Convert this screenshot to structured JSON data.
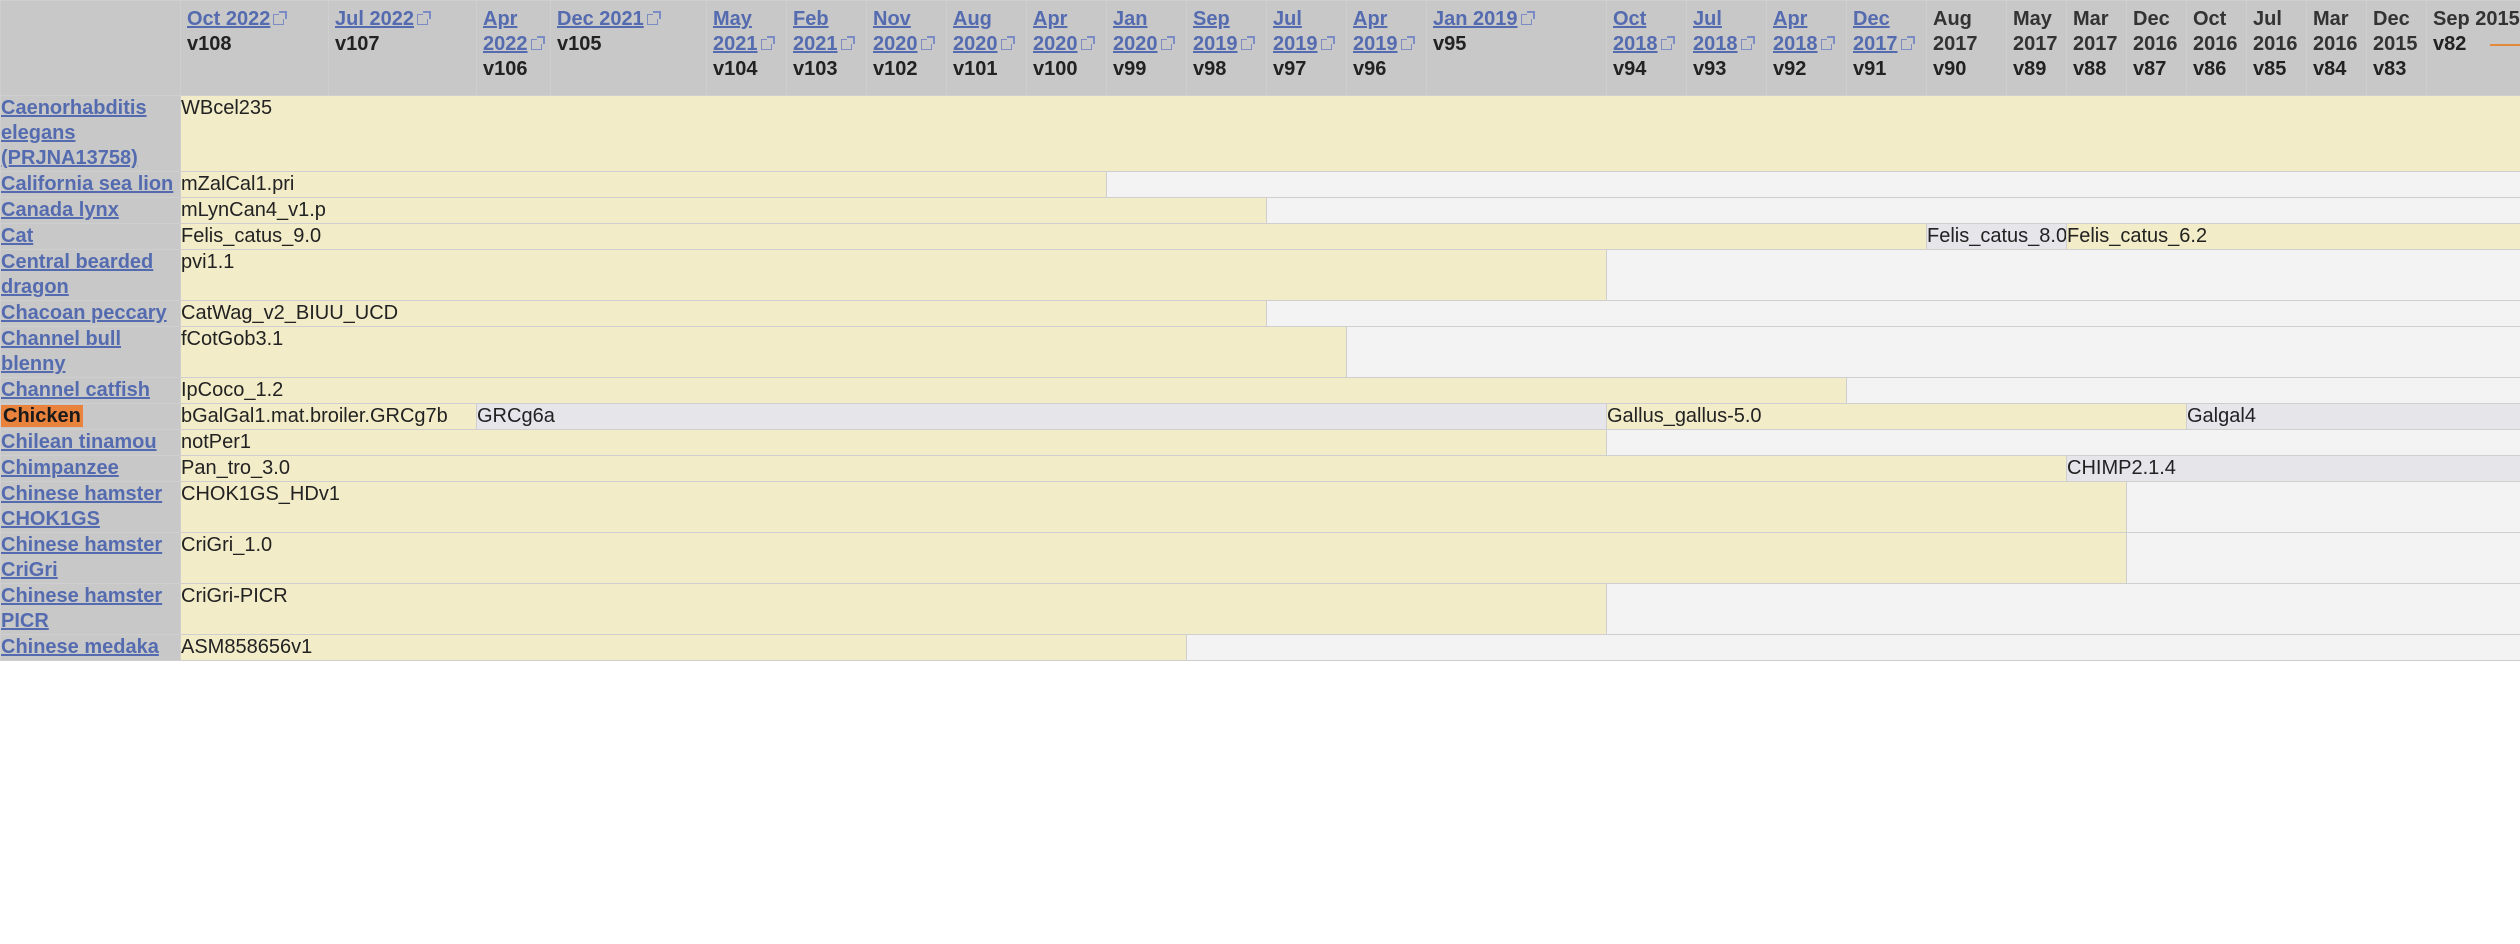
{
  "header": {
    "columns": [
      {
        "date": "Oct 2022",
        "version": "v108",
        "link": true
      },
      {
        "date": "Jul 2022",
        "version": "v107",
        "link": true
      },
      {
        "date": "Apr 2022",
        "version": "v106",
        "link": true
      },
      {
        "date": "Dec 2021",
        "version": "v105",
        "link": true
      },
      {
        "date": "May 2021",
        "version": "v104",
        "link": true
      },
      {
        "date": "Feb 2021",
        "version": "v103",
        "link": true
      },
      {
        "date": "Nov 2020",
        "version": "v102",
        "link": true
      },
      {
        "date": "Aug 2020",
        "version": "v101",
        "link": true
      },
      {
        "date": "Apr 2020",
        "version": "v100",
        "link": true
      },
      {
        "date": "Jan 2020",
        "version": "v99",
        "link": true
      },
      {
        "date": "Sep 2019",
        "version": "v98",
        "link": true
      },
      {
        "date": "Jul 2019",
        "version": "v97",
        "link": true
      },
      {
        "date": "Apr 2019",
        "version": "v96",
        "link": true
      },
      {
        "date": "Jan 2019",
        "version": "v95",
        "link": true
      },
      {
        "date": "Oct 2018",
        "version": "v94",
        "link": true
      },
      {
        "date": "Jul 2018",
        "version": "v93",
        "link": true
      },
      {
        "date": "Apr 2018",
        "version": "v92",
        "link": true
      },
      {
        "date": "Dec 2017",
        "version": "v91",
        "link": true
      },
      {
        "date": "Aug 2017",
        "version": "v90",
        "link": false
      },
      {
        "date": "May 2017",
        "version": "v89",
        "link": false
      },
      {
        "date": "Mar 2017",
        "version": "v88",
        "link": false
      },
      {
        "date": "Dec 2016",
        "version": "v87",
        "link": false
      },
      {
        "date": "Oct 2016",
        "version": "v86",
        "link": false
      },
      {
        "date": "Jul 2016",
        "version": "v85",
        "link": false
      },
      {
        "date": "Mar 2016",
        "version": "v84",
        "link": false
      },
      {
        "date": "Dec 2015",
        "version": "v83",
        "link": false
      },
      {
        "date": "Sep 2015",
        "version": "v82",
        "link": false
      }
    ]
  },
  "rows": [
    {
      "species": "Caenorhabditis elegans (PRJNA13758)",
      "cells": [
        {
          "text": "WBcel235",
          "span": 27
        }
      ]
    },
    {
      "species": "California sea lion",
      "cells": [
        {
          "text": "mZalCal1.pri",
          "span": 9
        },
        {
          "empty": true,
          "span": 18
        }
      ]
    },
    {
      "species": "Canada lynx",
      "cells": [
        {
          "text": "mLynCan4_v1.p",
          "span": 11
        },
        {
          "empty": true,
          "span": 16
        }
      ]
    },
    {
      "species": "Cat",
      "cells": [
        {
          "text": "Felis_catus_9.0",
          "span": 18
        },
        {
          "text": "Felis_catus_8.0",
          "span": 2,
          "alt": true
        },
        {
          "text": "Felis_catus_6.2",
          "span": 7
        }
      ]
    },
    {
      "species": "Central bearded dragon",
      "cells": [
        {
          "text": "pvi1.1",
          "span": 14
        },
        {
          "empty": true,
          "span": 13
        }
      ]
    },
    {
      "species": "Chacoan peccary",
      "cells": [
        {
          "text": "CatWag_v2_BIUU_UCD",
          "span": 11
        },
        {
          "empty": true,
          "span": 16
        }
      ]
    },
    {
      "species": "Channel bull blenny",
      "cells": [
        {
          "text": "fCotGob3.1",
          "span": 12
        },
        {
          "empty": true,
          "span": 15
        }
      ]
    },
    {
      "species": "Channel catfish",
      "cells": [
        {
          "text": "IpCoco_1.2",
          "span": 17
        },
        {
          "empty": true,
          "span": 10
        }
      ]
    },
    {
      "species": "Chicken",
      "highlight": true,
      "cells": [
        {
          "text": "bGalGal1.mat.broiler.GRCg7b",
          "span": 2
        },
        {
          "text": "GRCg6a",
          "span": 12,
          "alt": true
        },
        {
          "text": "Gallus_gallus-5.0",
          "span": 8
        },
        {
          "text": "Galgal4",
          "span": 5,
          "alt": true
        }
      ]
    },
    {
      "species": "Chilean tinamou",
      "cells": [
        {
          "text": "notPer1",
          "span": 14
        },
        {
          "empty": true,
          "span": 13
        }
      ]
    },
    {
      "species": "Chimpanzee",
      "cells": [
        {
          "text": "Pan_tro_3.0",
          "span": 20
        },
        {
          "text": "CHIMP2.1.4",
          "span": 7,
          "alt": true
        }
      ]
    },
    {
      "species": "Chinese hamster CHOK1GS",
      "cells": [
        {
          "text": "CHOK1GS_HDv1",
          "span": 21
        },
        {
          "empty": true,
          "span": 6
        }
      ]
    },
    {
      "species": "Chinese hamster CriGri",
      "cells": [
        {
          "text": "CriGri_1.0",
          "span": 21
        },
        {
          "empty": true,
          "span": 6
        }
      ]
    },
    {
      "species": "Chinese hamster PICR",
      "cells": [
        {
          "text": "CriGri-PICR",
          "span": 14
        },
        {
          "empty": true,
          "span": 13
        }
      ]
    },
    {
      "species": "Chinese medaka",
      "cells": [
        {
          "text": "ASM858656v1",
          "span": 10
        },
        {
          "empty": true,
          "span": 17
        }
      ]
    }
  ],
  "colors": {
    "header_bg": "#c8c8c8",
    "assembly_bg": "#f2ecc8",
    "alt_bg": "#e5e5ea",
    "empty_bg": "#f3f3f3",
    "link": "#556bb0",
    "highlight": "#e8823c"
  }
}
